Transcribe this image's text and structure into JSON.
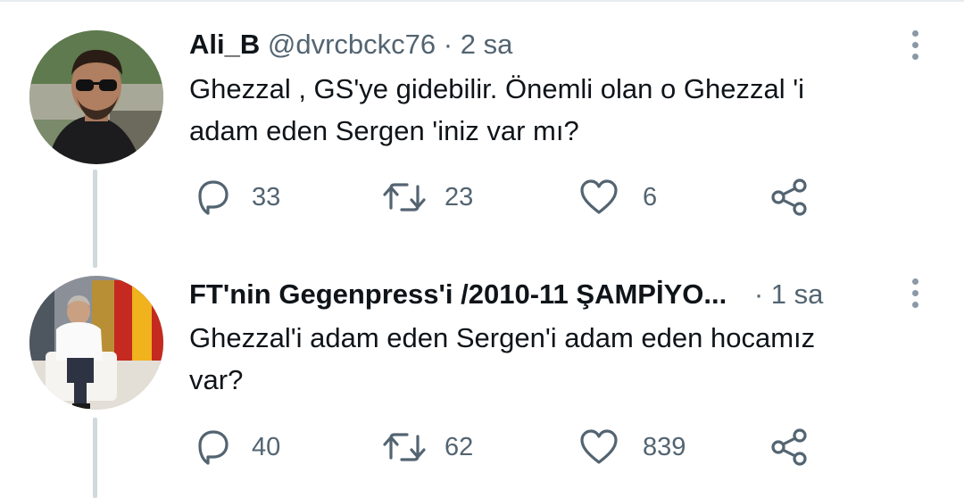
{
  "tweets": [
    {
      "name": "Ali_B",
      "handle": "@dvrcbckc76",
      "separator": "·",
      "time": "2 sa",
      "text_lines": [
        "Ghezzal , GS'ye gidebilir. Önemli olan o Ghezzal 'i",
        "adam eden Sergen 'iniz var mı?"
      ],
      "replies": "33",
      "retweets": "23",
      "likes": "6"
    },
    {
      "name": "FT'nin Gegenpress'i /2010-11 ŞAMPİYO...",
      "handle": "",
      "separator": "·",
      "time": "1 sa",
      "text_lines": [
        "Ghezzal'i adam eden Sergen'i adam eden hocamız",
        "var?"
      ],
      "replies": "40",
      "retweets": "62",
      "likes": "839"
    }
  ],
  "icons": {
    "reply": "reply-icon",
    "retweet": "retweet-icon",
    "like": "heart-icon",
    "share": "share-icon",
    "more": "more-vertical-icon"
  },
  "colors": {
    "text": "#0f1419",
    "secondary": "#536471",
    "thread_line": "#cfd9de",
    "divider": "#e6ecf0"
  }
}
